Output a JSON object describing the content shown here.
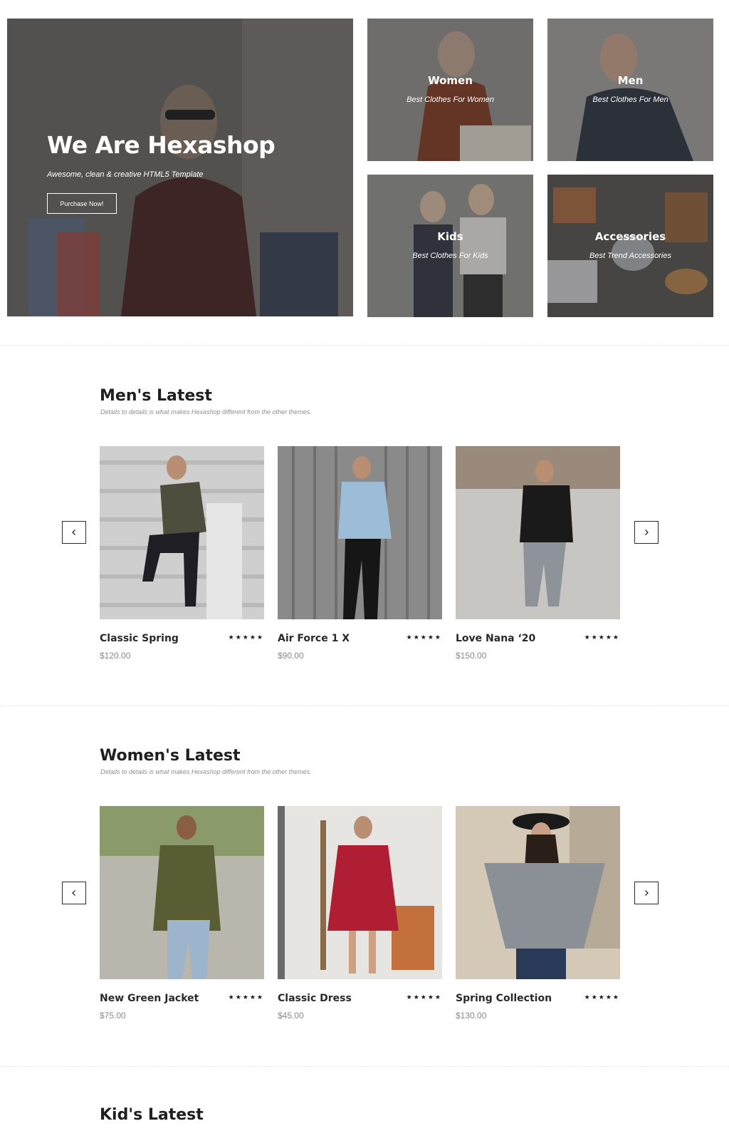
{
  "hero": {
    "title": "We Are Hexashop",
    "subtitle": "Awesome, clean & creative HTML5 Template",
    "button_label": "Purchase Now!"
  },
  "categories": [
    {
      "title": "Women",
      "subtitle": "Best Clothes For Women"
    },
    {
      "title": "Men",
      "subtitle": "Best Clothes For Men"
    },
    {
      "title": "Kids",
      "subtitle": "Best Clothes For Kids"
    },
    {
      "title": "Accessories",
      "subtitle": "Best Trend Accessories"
    }
  ],
  "mens": {
    "title": "Men's Latest",
    "subtitle": "Details to details is what makes Hexashop different from the other themes.",
    "products": [
      {
        "name": "Classic Spring",
        "price": "$120.00",
        "rating": "★★★★★"
      },
      {
        "name": "Air Force 1 X",
        "price": "$90.00",
        "rating": "★★★★★"
      },
      {
        "name": "Love Nana ‘20",
        "price": "$150.00",
        "rating": "★★★★★"
      }
    ]
  },
  "womens": {
    "title": "Women's Latest",
    "subtitle": "Details to details is what makes Hexashop different from the other themes.",
    "products": [
      {
        "name": "New Green Jacket",
        "price": "$75.00",
        "rating": "★★★★★"
      },
      {
        "name": "Classic Dress",
        "price": "$45.00",
        "rating": "★★★★★"
      },
      {
        "name": "Spring Collection",
        "price": "$130.00",
        "rating": "★★★★★"
      }
    ]
  },
  "kids": {
    "title": "Kid's Latest"
  },
  "icons": {
    "prev": "chevron-left-icon",
    "next": "chevron-right-icon",
    "rating": "star-icon"
  },
  "colors": {
    "text": "#2a2a2a",
    "muted": "#8a8a8a",
    "overlay": "#3c3c3c"
  }
}
